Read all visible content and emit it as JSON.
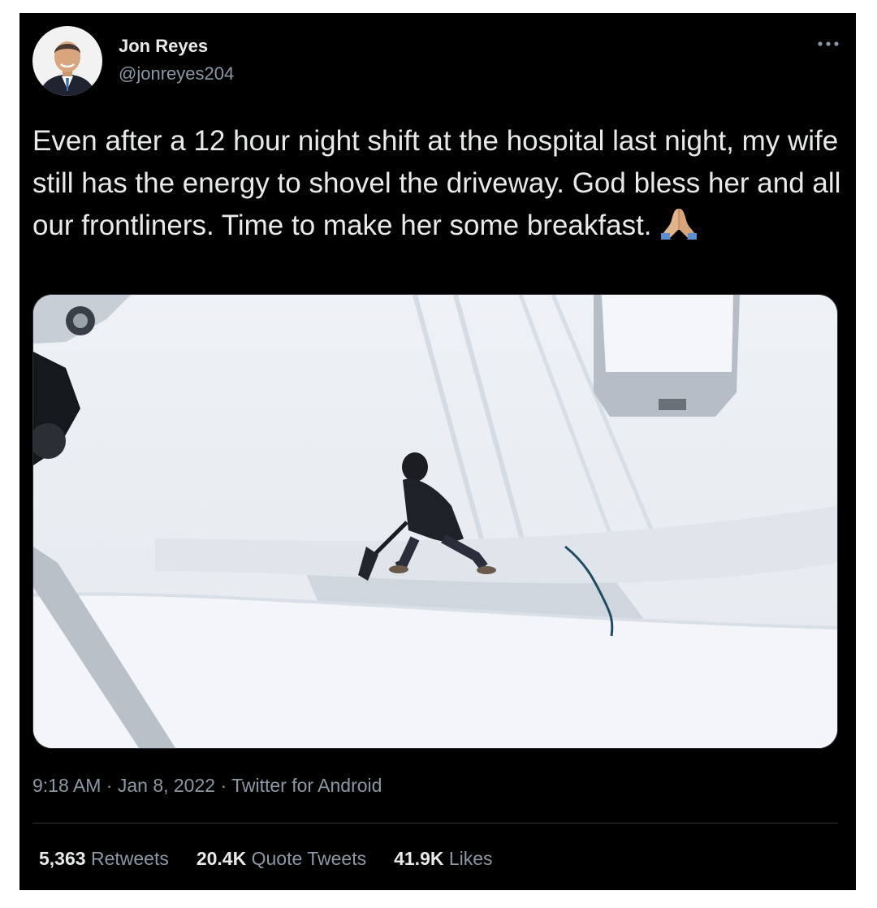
{
  "author": {
    "name": "Jon Reyes",
    "handle": "@jonreyes204"
  },
  "tweet": {
    "text": "Even after a 12 hour night shift at the hospital last night, my wife still has the energy to shovel the driveway. God bless her and all our frontliners. Time to make her some breakfast.",
    "emoji": "folded-hands-emoji",
    "media_icon": "photo-snow-driveway"
  },
  "meta": {
    "time": "9:18 AM",
    "separator1": " · ",
    "date": "Jan 8, 2022",
    "separator2": " · ",
    "source": "Twitter for Android"
  },
  "stats": {
    "retweets_count": "5,363",
    "retweets_label": "Retweets",
    "quotes_count": "20.4K",
    "quotes_label": "Quote Tweets",
    "likes_count": "41.9K",
    "likes_label": "Likes"
  },
  "colors": {
    "background": "#000000",
    "text": "#e7e9ea",
    "secondary": "#8b98a5",
    "divider": "#2f3336"
  },
  "icons": {
    "more": "more-horizontal-icon"
  }
}
